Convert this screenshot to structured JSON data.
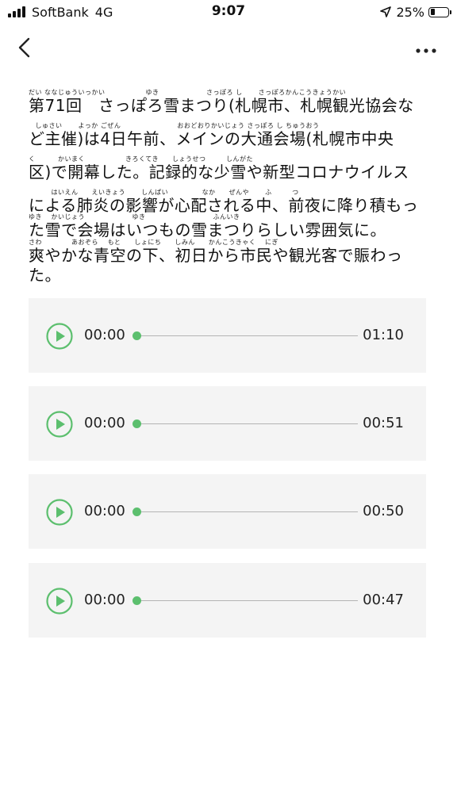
{
  "status_bar": {
    "carrier": "SoftBank",
    "network": "4G",
    "time": "9:07",
    "battery_percent": "25%",
    "battery_level": 0.25
  },
  "nav": {
    "back_icon": "chevron-left-icon",
    "more_icon": "more-horizontal-icon"
  },
  "article": {
    "lines": [
      {
        "ruby": "だい ななじゅういっかい　　　　　　ゆき　　　　　　　さっぽろ し　　 さっぽろかんこうきょうかい",
        "text": "第71回　さっぽろ雪まつり(札幌市、札幌観光協会な"
      },
      {
        "ruby": "　しゅさい　　 よっか ごぜん　　　　　　　　 おおどおりかいじょう さっぽろ し ちゅうおう",
        "text": "ど主催)は4日午前、メインの大通会場(札幌市中央"
      },
      {
        "ruby": "く　　　 かいまく　　　　　　きろくてき　　しょうせつ　　　しんがた",
        "text": "区)で開幕した。記録的な少雪や新型コロナウイルス"
      },
      {
        "ruby": "　　　 はいえん　　えいきょう　　 しんぱい　　　　　なか　　ぜんや　　 ふ　　　つ",
        "text": "による肺炎の影響が心配される中、前夜に降り積もっ"
      },
      {
        "ruby": "ゆき　 かいじょう　　　　　　　ゆき　　　　　　　　　　ふんいき",
        "text": "た雪で会場はいつもの雪まつりらしい雰囲気に。"
      },
      {
        "ruby": "さわ　　　　 あおぞら　 もと　　しょにち　　しみん　　かんこうきゃく　 にぎ",
        "text": "爽やかな青空の下、初日から市民や観光客で賑わっ"
      },
      {
        "ruby": "",
        "text": "た。"
      }
    ]
  },
  "audio_players": [
    {
      "current": "00:00",
      "duration": "01:10",
      "progress": 0
    },
    {
      "current": "00:00",
      "duration": "00:51",
      "progress": 0
    },
    {
      "current": "00:00",
      "duration": "00:50",
      "progress": 0
    },
    {
      "current": "00:00",
      "duration": "00:47",
      "progress": 0
    }
  ],
  "colors": {
    "accent": "#5cbf6e",
    "card_bg": "#f4f4f4"
  }
}
